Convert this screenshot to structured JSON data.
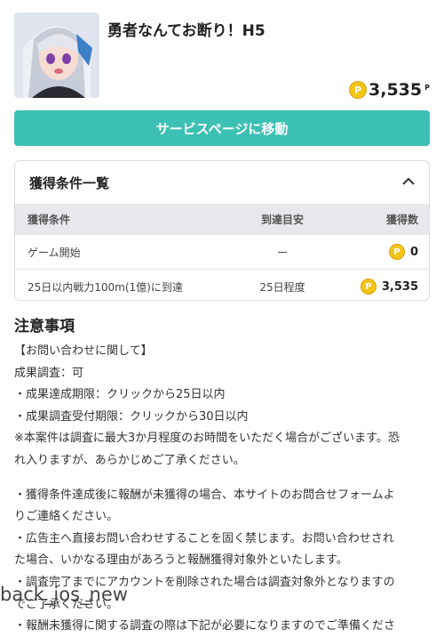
{
  "header": {
    "title": "勇者なんてお断り！H5",
    "points_value": "3,535",
    "points_unit": "P",
    "coin_symbol": "P"
  },
  "service_button": {
    "label": "サービスページに移動"
  },
  "conditions": {
    "title": "獲得条件一覧",
    "columns": [
      "獲得条件",
      "到達目安",
      "獲得数"
    ],
    "rows": [
      {
        "condition": "ゲーム開始",
        "target": "ー",
        "reward": "0"
      },
      {
        "condition": "25日以内戦力100m(1億)に到達",
        "target": "25日程度",
        "reward": "3,535"
      }
    ]
  },
  "notes": {
    "title": "注意事項",
    "lines": [
      "【お問い合わせに関して】",
      "成果調査：可",
      "・成果達成期限：クリックから25日以内",
      "・成果調査受付期限：クリックから30日以内",
      "※本案件は調査に最大3か月程度のお時間をいただく場合がございます。恐",
      "れ入りますが、あらかじめご了承ください。",
      "・獲得条件達成後に報酬が未獲得の場合、本サイトのお問合せフォームよ",
      "りご連絡ください。",
      "・広告主へ直接お問い合わせすることを固く禁じます。お問い合わせされ",
      "た場合、いかなる理由があろうと報酬獲得対象外といたします。",
      "・調査完了までにアカウントを削除された場合は調査対象外となりますの",
      "でご了承ください。",
      "・報酬未獲得に関する調査の際は下記が必要になりますのでご準備くださ"
    ]
  },
  "bottom_nav": {
    "label": "back_ios_new"
  },
  "colors": {
    "accent": "#3cc0b4",
    "coin": "#f3c316"
  }
}
